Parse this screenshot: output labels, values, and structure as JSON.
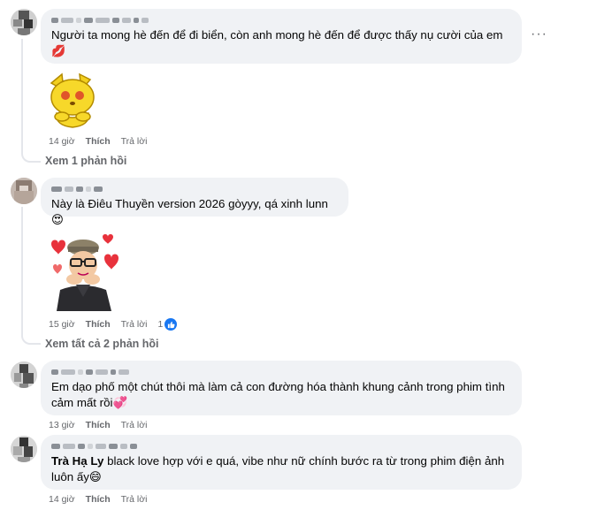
{
  "comments": [
    {
      "text": "Người ta mong hè đến để đi biển, còn anh mong hè đến để được thấy nụ cười của em",
      "reaction_emoji": "💋",
      "sticker_icon": "yellow-cat-sticker",
      "time": "14 giờ",
      "like_label": "Thích",
      "reply_label": "Trả lời",
      "view_replies": "Xem 1 phản hồi"
    },
    {
      "text": "Này là Điêu Thuyền version 2026 gòyyy, qá xinh lunn",
      "emoji": "😍",
      "sticker_icon": "boy-hearts-sticker",
      "time": "15 giờ",
      "like_label": "Thích",
      "reply_label": "Trả lời",
      "reaction_count": "1",
      "view_replies": "Xem tất cả 2 phản hồi"
    },
    {
      "text": "Em dạo phố một chút thôi mà làm cả con đường hóa thành khung cảnh trong phim tình cảm mất rồi",
      "emoji": "💞",
      "time": "13 giờ",
      "like_label": "Thích",
      "reply_label": "Trả lời"
    },
    {
      "mention": "Trà Hạ Ly",
      "text": " black love hợp với e quá, vibe như nữ chính bước ra từ trong phim điện ảnh luôn ấy",
      "emoji": "😄",
      "time": "14 giờ",
      "like_label": "Thích",
      "reply_label": "Trả lời"
    }
  ],
  "more_options": "···",
  "colors": {
    "bubble": "#f0f2f5",
    "meta": "#65676b",
    "like_blue": "#1877f2",
    "thread": "#e4e6eb"
  }
}
